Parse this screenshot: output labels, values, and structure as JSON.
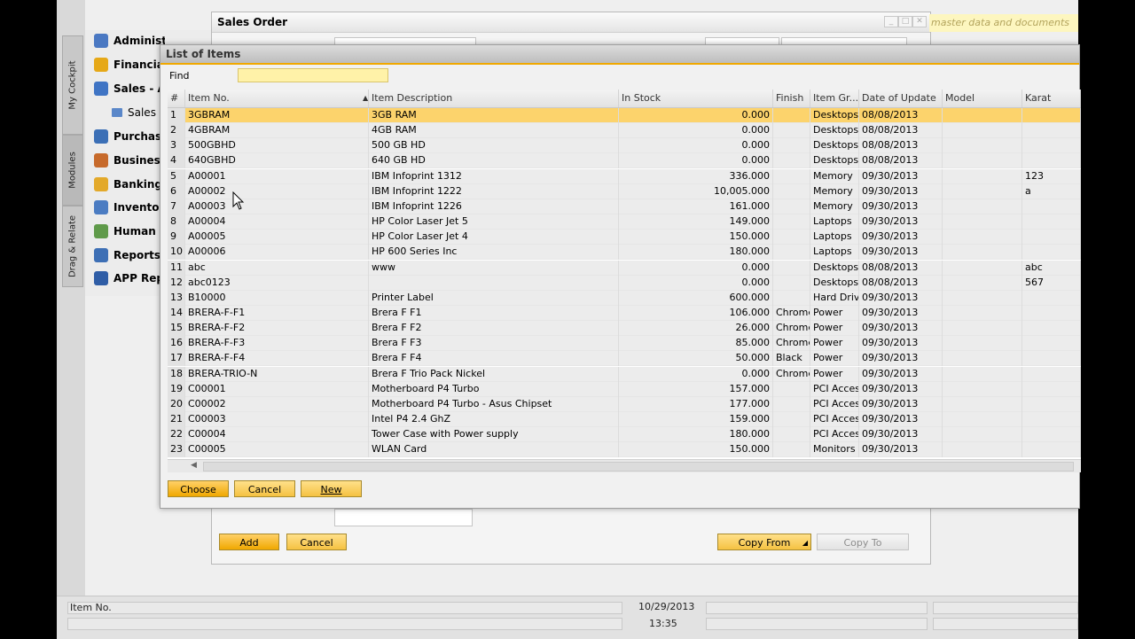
{
  "left_tabs": [
    "My Cockpit",
    "Modules",
    "Drag & Relate"
  ],
  "modules": [
    {
      "label": "Administration",
      "icon": "administration-icon",
      "color": "#4a78c2"
    },
    {
      "label": "Financials",
      "icon": "financials-icon",
      "color": "#e6a817"
    },
    {
      "label": "Sales - A/R",
      "icon": "sales-icon",
      "color": "#3f74c4"
    },
    {
      "label": "Sales",
      "icon": "document-icon",
      "color": "#5a87c9"
    },
    {
      "label": "Purchasing",
      "icon": "purchasing-icon",
      "color": "#3b6fb6"
    },
    {
      "label": "Business Partners",
      "icon": "business-partners-icon",
      "color": "#c76a2b"
    },
    {
      "label": "Banking",
      "icon": "banking-icon",
      "color": "#e3a92a"
    },
    {
      "label": "Inventory",
      "icon": "inventory-icon",
      "color": "#4b7cc2"
    },
    {
      "label": "Human Resources",
      "icon": "human-resources-icon",
      "color": "#5f9a4a"
    },
    {
      "label": "Reports",
      "icon": "reports-icon",
      "color": "#3d6fb5"
    },
    {
      "label": "APP Reports",
      "icon": "app-reports-icon",
      "color": "#2f5da6"
    }
  ],
  "sales_order": {
    "title": "Sales Order",
    "hint": "master data and documents",
    "add_label": "Add",
    "cancel_label": "Cancel",
    "copy_from_label": "Copy From",
    "copy_to_label": "Copy To"
  },
  "dialog": {
    "title": "List of Items",
    "find_label": "Find",
    "find_value": "",
    "columns": [
      "#",
      "Item No.",
      "Item Description",
      "In Stock",
      "Finish",
      "Item Gr...",
      "Date of Update",
      "Model",
      "Karat"
    ],
    "rows": [
      [
        "1",
        "3GBRAM",
        "3GB RAM",
        "0.000",
        "",
        "Desktops",
        "08/08/2013",
        "",
        ""
      ],
      [
        "2",
        "4GBRAM",
        "4GB RAM",
        "0.000",
        "",
        "Desktops",
        "08/08/2013",
        "",
        ""
      ],
      [
        "3",
        "500GBHD",
        "500 GB HD",
        "0.000",
        "",
        "Desktops",
        "08/08/2013",
        "",
        ""
      ],
      [
        "4",
        "640GBHD",
        "640 GB HD",
        "0.000",
        "",
        "Desktops",
        "08/08/2013",
        "",
        ""
      ],
      [
        "5",
        "A00001",
        "IBM Infoprint 1312",
        "336.000",
        "",
        "Memory",
        "09/30/2013",
        "",
        "123"
      ],
      [
        "6",
        "A00002",
        "IBM Infoprint 1222",
        "10,005.000",
        "",
        "Memory",
        "09/30/2013",
        "",
        "a"
      ],
      [
        "7",
        "A00003",
        "IBM Infoprint 1226",
        "161.000",
        "",
        "Memory",
        "09/30/2013",
        "",
        ""
      ],
      [
        "8",
        "A00004",
        "HP Color Laser Jet 5",
        "149.000",
        "",
        "Laptops",
        "09/30/2013",
        "",
        ""
      ],
      [
        "9",
        "A00005",
        "HP Color Laser Jet 4",
        "150.000",
        "",
        "Laptops",
        "09/30/2013",
        "",
        ""
      ],
      [
        "10",
        "A00006",
        "HP 600 Series Inc",
        "180.000",
        "",
        "Laptops",
        "09/30/2013",
        "",
        ""
      ],
      [
        "11",
        "abc",
        "www",
        "0.000",
        "",
        "Desktops",
        "08/08/2013",
        "",
        "abc"
      ],
      [
        "12",
        "abc0123",
        "",
        "0.000",
        "",
        "Desktops",
        "08/08/2013",
        "",
        "567"
      ],
      [
        "13",
        "B10000",
        "Printer Label",
        "600.000",
        "",
        "Hard Drive",
        "09/30/2013",
        "",
        ""
      ],
      [
        "14",
        "BRERA-F-F1",
        "Brera F F1",
        "106.000",
        "Chrome",
        "Power",
        "09/30/2013",
        "",
        ""
      ],
      [
        "15",
        "BRERA-F-F2",
        "Brera F F2",
        "26.000",
        "Chrome",
        "Power",
        "09/30/2013",
        "",
        ""
      ],
      [
        "16",
        "BRERA-F-F3",
        "Brera F F3",
        "85.000",
        "Chrome",
        "Power",
        "09/30/2013",
        "",
        ""
      ],
      [
        "17",
        "BRERA-F-F4",
        "Brera F F4",
        "50.000",
        "Black",
        "Power",
        "09/30/2013",
        "",
        ""
      ],
      [
        "18",
        "BRERA-TRIO-N",
        "Brera F Trio Pack Nickel",
        "0.000",
        "Chrome",
        "Power",
        "09/30/2013",
        "",
        ""
      ],
      [
        "19",
        "C00001",
        "Motherboard P4 Turbo",
        "157.000",
        "",
        "PCI Access",
        "09/30/2013",
        "",
        ""
      ],
      [
        "20",
        "C00002",
        "Motherboard P4 Turbo - Asus Chipset",
        "177.000",
        "",
        "PCI Access",
        "09/30/2013",
        "",
        ""
      ],
      [
        "21",
        "C00003",
        "Intel P4 2.4 GhZ",
        "159.000",
        "",
        "PCI Access",
        "09/30/2013",
        "",
        ""
      ],
      [
        "22",
        "C00004",
        "Tower Case with Power supply",
        "180.000",
        "",
        "PCI Access",
        "09/30/2013",
        "",
        ""
      ],
      [
        "23",
        "C00005",
        "WLAN Card",
        "150.000",
        "",
        "Monitors",
        "09/30/2013",
        "",
        ""
      ]
    ],
    "selected_row": 1,
    "choose_label": "Choose",
    "cancel_label": "Cancel",
    "new_label": "New"
  },
  "status_bar": {
    "field_label": "Item No.",
    "date": "10/29/2013",
    "time": "13:35"
  },
  "colors": {
    "selection": "#fcd36c",
    "button": "#f5c242",
    "accent": "#f0a800"
  }
}
